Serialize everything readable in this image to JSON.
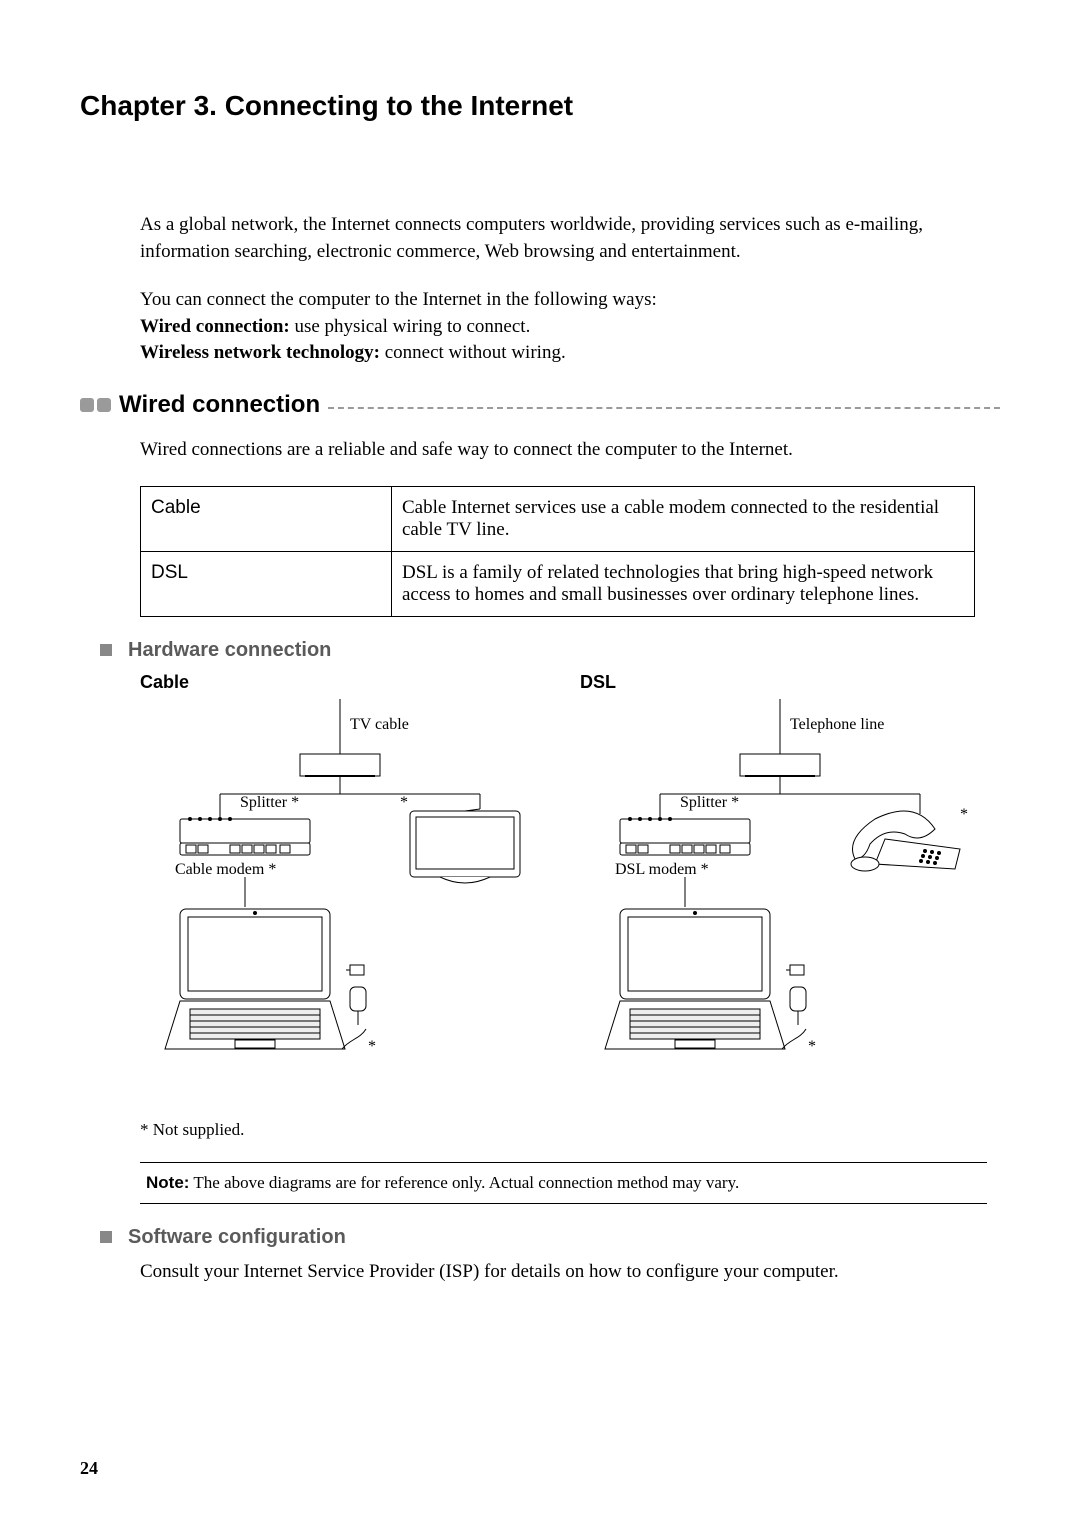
{
  "chapter_title": "Chapter 3. Connecting to the Internet",
  "intro_para": "As a global network, the Internet connects computers worldwide, providing services such as e-mailing, information searching, electronic commerce, Web browsing and entertainment.",
  "connect_para": "You can connect the computer to the Internet in the following ways:",
  "wired_line_label": "Wired connection: ",
  "wired_line_text": "use physical wiring to connect.",
  "wireless_line_label": "Wireless network technology: ",
  "wireless_line_text": "connect without wiring.",
  "section_wired": "Wired connection",
  "wired_desc": "Wired connections are a reliable and safe way to connect the computer to the Internet.",
  "table": {
    "cable_head": "Cable",
    "cable_body": "Cable Internet services use a cable modem connected to the residential cable TV line.",
    "dsl_head": "DSL",
    "dsl_body": "DSL is a family of related technologies that bring high-speed network access to homes and small businesses over ordinary telephone lines."
  },
  "hardware_section": "Hardware connection",
  "diag_cable_title": "Cable",
  "diag_dsl_title": "DSL",
  "labels": {
    "tv_cable": "TV cable",
    "splitter": "Splitter *",
    "asterisk": "*",
    "cable_modem": "Cable modem *",
    "telephone_line": "Telephone line",
    "dsl_modem": "DSL modem *",
    "not_supplied": "* Not supplied."
  },
  "note_label": "Note:",
  "note_text": "The above diagrams are for reference only. Actual connection method may vary.",
  "software_section": "Software configuration",
  "software_text": "Consult your Internet Service Provider (ISP) for details on how to configure your computer.",
  "page_number": "24"
}
